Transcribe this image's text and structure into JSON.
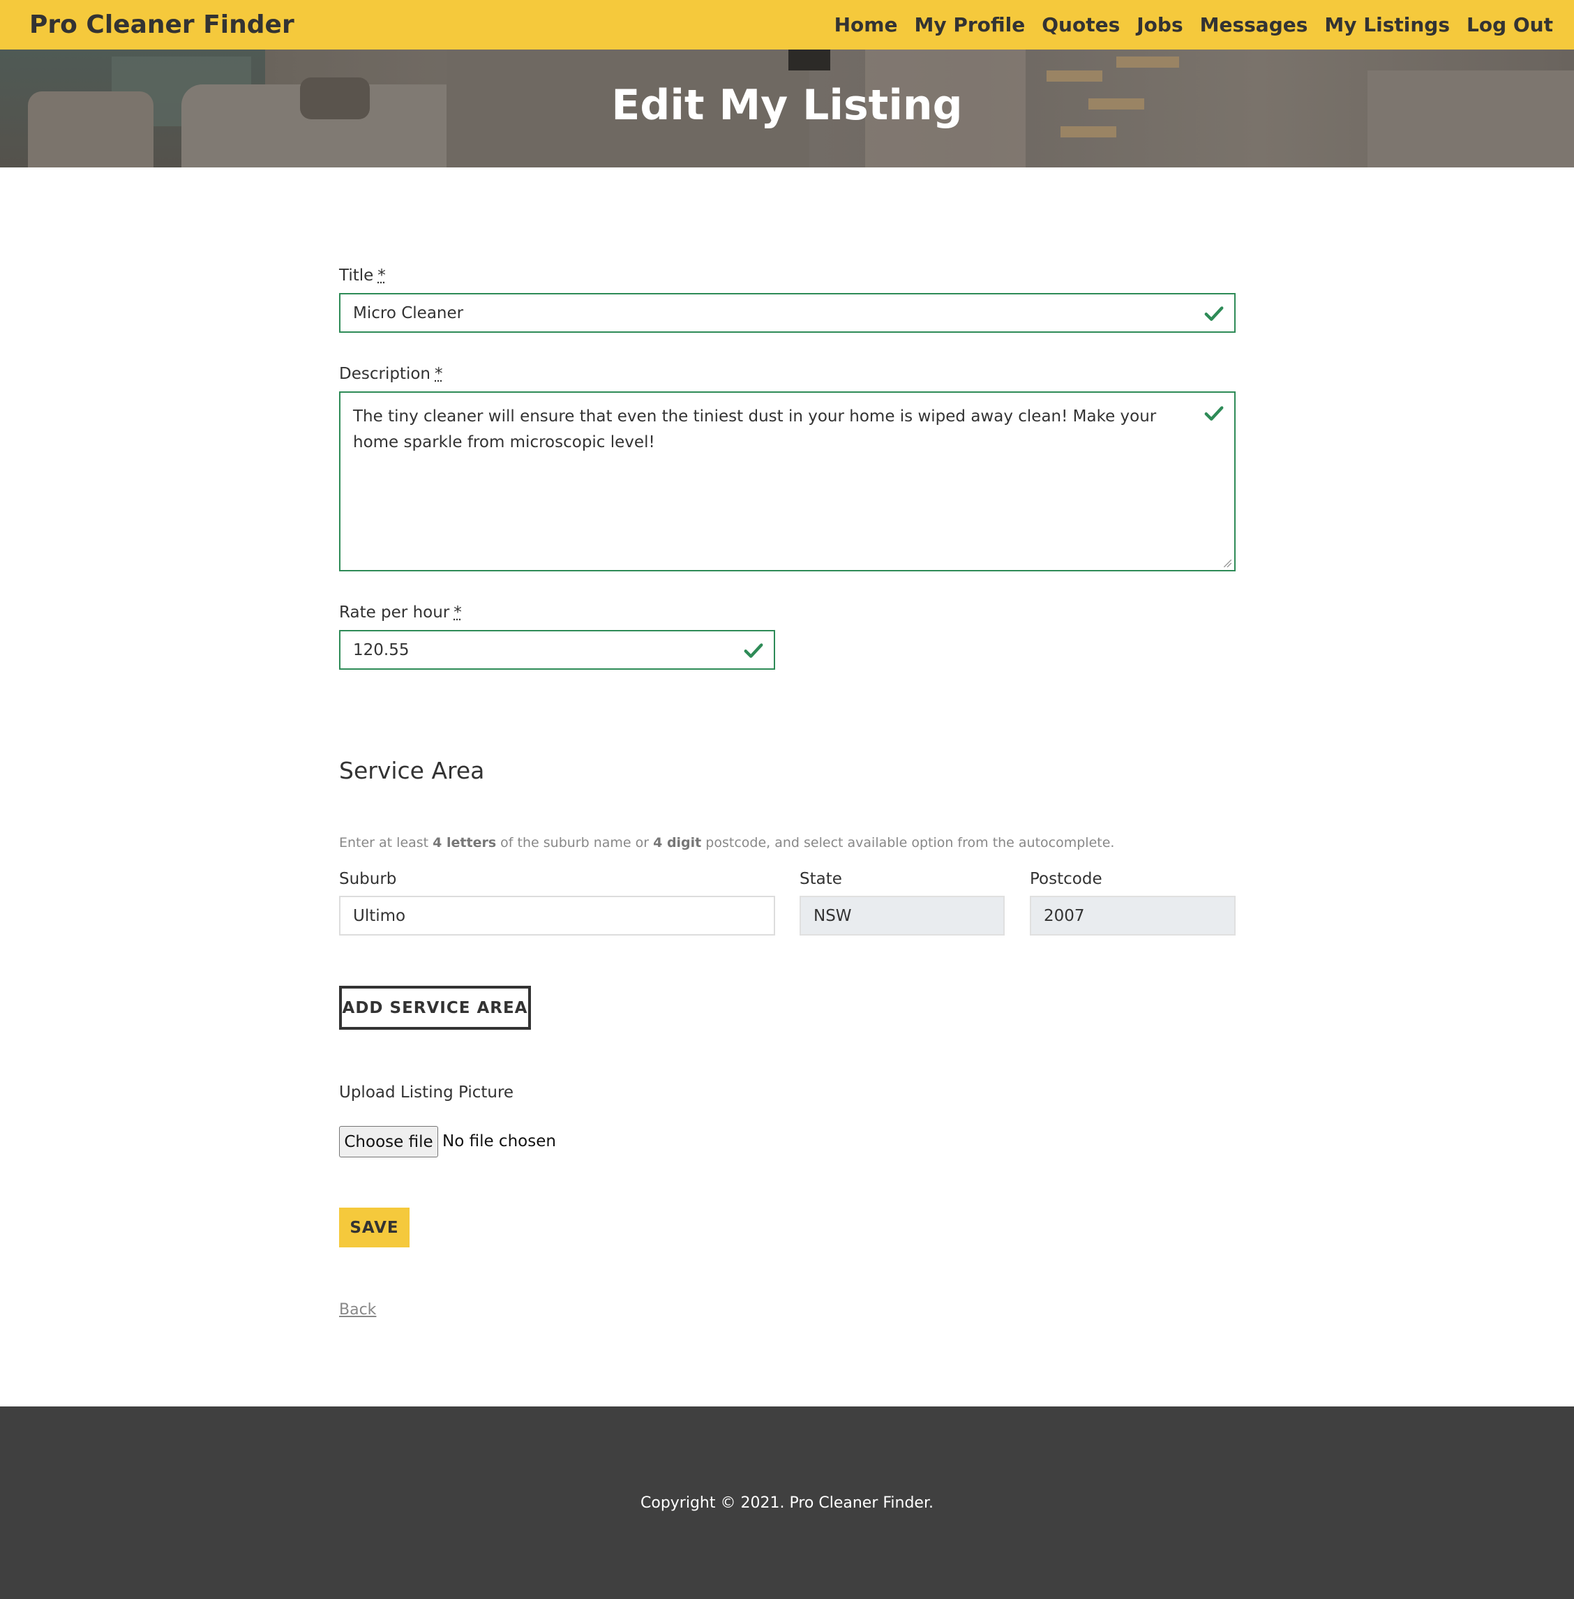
{
  "brand": "Pro Cleaner Finder",
  "nav": [
    "Home",
    "My Profile",
    "Quotes",
    "Jobs",
    "Messages",
    "My Listings",
    "Log Out"
  ],
  "hero_title": "Edit My Listing",
  "form": {
    "title_label": "Title",
    "title_value": "Micro Cleaner",
    "required_mark": "*",
    "description_label": "Description",
    "description_value": "The tiny cleaner will ensure that even the tiniest dust in your home is wiped away clean! Make your home sparkle from microscopic level!",
    "rate_label": "Rate per hour",
    "rate_value": "120.55"
  },
  "service_area": {
    "heading": "Service Area",
    "hint_1": "Enter at least ",
    "hint_b1": "4 letters",
    "hint_2": " of the suburb name or ",
    "hint_b2": "4 digit",
    "hint_3": " postcode, and select available option from the autocomplete.",
    "suburb_label": "Suburb",
    "suburb_value": "Ultimo",
    "state_label": "State",
    "state_value": "NSW",
    "postcode_label": "Postcode",
    "postcode_value": "2007",
    "add_button": "ADD SERVICE AREA"
  },
  "upload": {
    "label": "Upload Listing Picture",
    "choose_button": "Choose file",
    "status": "No file chosen"
  },
  "save_button": "SAVE",
  "back_link": "Back",
  "footer": "Copyright © 2021. Pro Cleaner Finder.",
  "colors": {
    "brand_yellow": "#f5c93c",
    "valid_green": "#2e8b57",
    "footer_bg": "#404040"
  }
}
